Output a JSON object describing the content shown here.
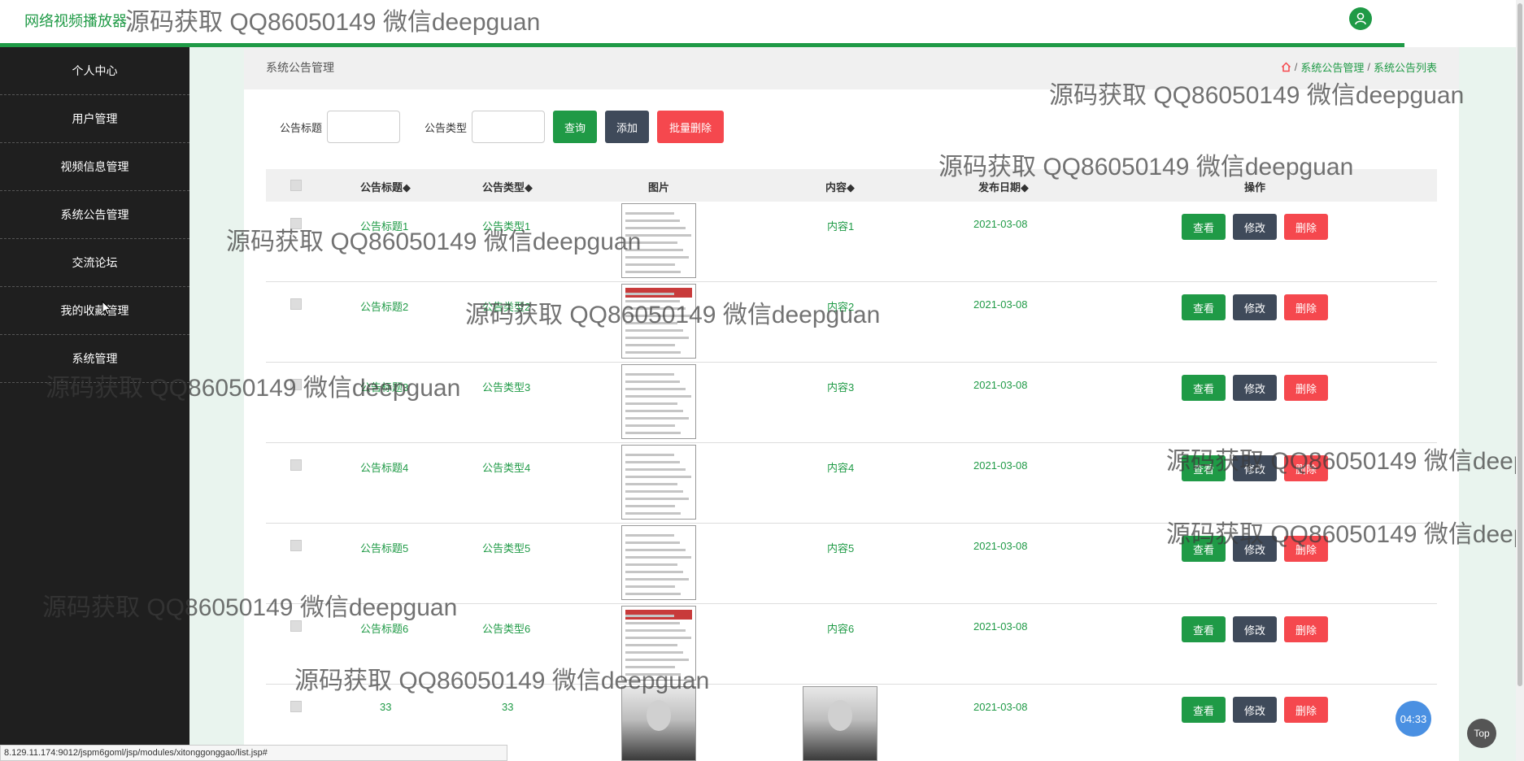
{
  "header": {
    "app_title": "网络视频播放器",
    "watermark_text": "源码获取 QQ86050149 微信deepguan"
  },
  "sidebar": {
    "items": [
      {
        "label": "个人中心"
      },
      {
        "label": "用户管理"
      },
      {
        "label": "视频信息管理"
      },
      {
        "label": "系统公告管理"
      },
      {
        "label": "交流论坛"
      },
      {
        "label": "我的收藏管理"
      },
      {
        "label": "系统管理"
      }
    ]
  },
  "breadcrumb": {
    "page_title": "系统公告管理",
    "crumb_1": "系统公告管理",
    "sep": "/",
    "crumb_2": "系统公告列表"
  },
  "search": {
    "title_label": "公告标题",
    "title_value": "",
    "type_label": "公告类型",
    "type_value": "",
    "query_label": "查询",
    "add_label": "添加",
    "batch_delete_label": "批量删除"
  },
  "table": {
    "headers": {
      "title": "公告标题",
      "type": "公告类型",
      "image": "图片",
      "content": "内容",
      "date": "发布日期",
      "actions": "操作"
    },
    "rows": [
      {
        "title": "公告标题1",
        "type": "公告类型1",
        "content": "内容1",
        "date": "2021-03-08",
        "view": "查看",
        "edit": "修改",
        "delete": "删除"
      },
      {
        "title": "公告标题2",
        "type": "公告类型2",
        "content": "内容2",
        "date": "2021-03-08",
        "view": "查看",
        "edit": "修改",
        "delete": "删除"
      },
      {
        "title": "公告标题3",
        "type": "公告类型3",
        "content": "内容3",
        "date": "2021-03-08",
        "view": "查看",
        "edit": "修改",
        "delete": "删除"
      },
      {
        "title": "公告标题4",
        "type": "公告类型4",
        "content": "内容4",
        "date": "2021-03-08",
        "view": "查看",
        "edit": "修改",
        "delete": "删除"
      },
      {
        "title": "公告标题5",
        "type": "公告类型5",
        "content": "内容5",
        "date": "2021-03-08",
        "view": "查看",
        "edit": "修改",
        "delete": "删除"
      },
      {
        "title": "公告标题6",
        "type": "公告类型6",
        "content": "内容6",
        "date": "2021-03-08",
        "view": "查看",
        "edit": "修改",
        "delete": "删除"
      },
      {
        "title": "33",
        "type": "33",
        "content": "",
        "date": "2021-03-08",
        "view": "查看",
        "edit": "修改",
        "delete": "删除"
      }
    ]
  },
  "floating": {
    "timer": "04:33",
    "top_label": "Top"
  },
  "status_bar": {
    "url": "8.129.11.174:9012/jspm6goml/jsp/modules/xitonggonggao/list.jsp#"
  },
  "colors": {
    "accent": "#1f9a46",
    "edit": "#3f4a5a",
    "danger": "#f5484e",
    "sidebar_bg": "#1f1f1f"
  }
}
